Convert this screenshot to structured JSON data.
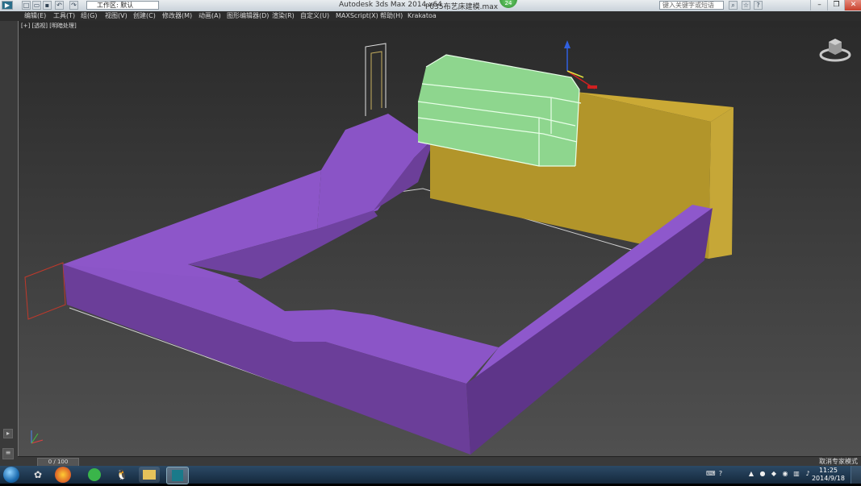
{
  "window": {
    "app_title": "Autodesk 3ds Max  2014 x64",
    "file_name": "P035布艺床建模.max",
    "workspace": "工作区: 默认",
    "search_placeholder": "键入关键字或短语",
    "badge_count": "24"
  },
  "menu": [
    "编辑(E)",
    "工具(T)",
    "组(G)",
    "视图(V)",
    "创建(C)",
    "修改器(M)",
    "动画(A)",
    "图形编辑器(D)",
    "渲染(R)",
    "自定义(U)",
    "MAXScript(X)",
    "帮助(H)",
    "Krakatoa"
  ],
  "viewport": {
    "label": "[+] [透视] [明暗处理]",
    "colors": {
      "sofa_top": "#8d56c9",
      "sofa_front": "#6c3f99",
      "headboard": "#c2a22e",
      "bolster": "#8fd88f",
      "grid": "#d0d0d0"
    }
  },
  "timeline": {
    "frame": "0 / 100"
  },
  "statusbar": {
    "text": "取消专家模式"
  },
  "taskbar": {
    "time": "11:25",
    "date": "2014/9/18"
  },
  "icons": [
    "app-logo-icon",
    "new-icon",
    "open-icon",
    "save-icon",
    "undo-icon",
    "redo-icon",
    "viewcube-icon",
    "start-orb-icon",
    "360-browser-icon",
    "qq-icon",
    "folder-icon",
    "3dsmax-icon"
  ]
}
